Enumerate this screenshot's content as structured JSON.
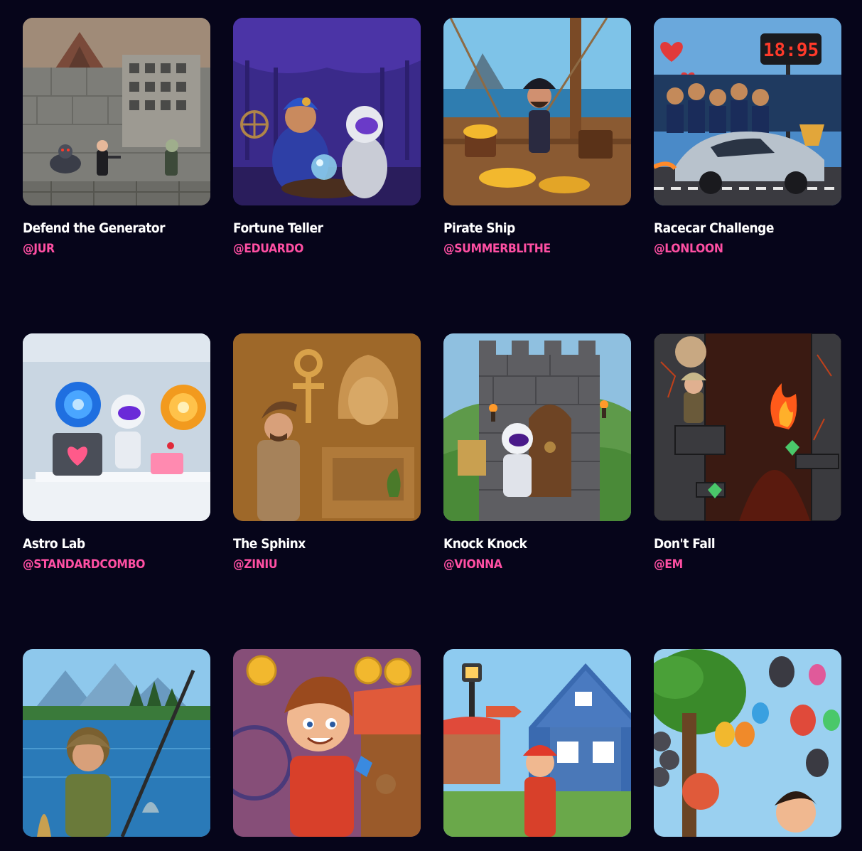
{
  "games": [
    {
      "title": "Defend the Generator",
      "author": "@JUR",
      "thumbnail_icon": "soldier-zombie-scene"
    },
    {
      "title": "Fortune Teller",
      "author": "@EDUARDO",
      "thumbnail_icon": "crystal-ball-scene"
    },
    {
      "title": "Pirate Ship",
      "author": "@SUMMERBLITHE",
      "thumbnail_icon": "pirate-treasure-scene"
    },
    {
      "title": "Racecar Challenge",
      "author": "@LONLOON",
      "thumbnail_icon": "racecar-scene"
    },
    {
      "title": "Astro Lab",
      "author": "@STANDARDCOMBO",
      "thumbnail_icon": "portal-lab-scene"
    },
    {
      "title": "The Sphinx",
      "author": "@ZINIU",
      "thumbnail_icon": "sphinx-scene"
    },
    {
      "title": "Knock Knock",
      "author": "@VIONNA",
      "thumbnail_icon": "castle-door-scene"
    },
    {
      "title": "Don't Fall",
      "author": "@EM",
      "thumbnail_icon": "lava-cave-scene"
    },
    {
      "title": "",
      "author": "",
      "thumbnail_icon": "fishing-lake-scene"
    },
    {
      "title": "",
      "author": "",
      "thumbnail_icon": "carnival-coins-scene"
    },
    {
      "title": "",
      "author": "",
      "thumbnail_icon": "town-house-scene"
    },
    {
      "title": "",
      "author": "",
      "thumbnail_icon": "balloons-scene"
    }
  ],
  "colors": {
    "background": "#06051a",
    "title": "#ffffff",
    "author": "#ff4fa3"
  }
}
